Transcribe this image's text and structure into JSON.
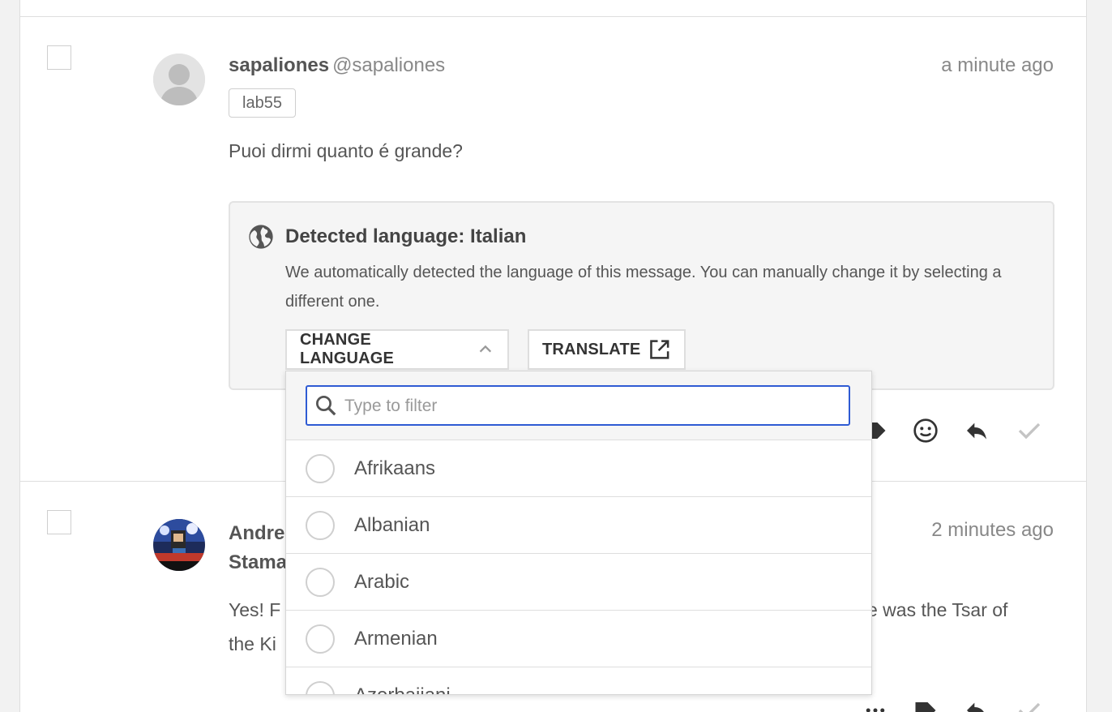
{
  "comments": [
    {
      "author": "sapaliones",
      "handle": "@sapaliones",
      "time": "a minute ago",
      "tag": "lab55",
      "message": "Puoi dirmi quanto é grande?",
      "language_box": {
        "title": "Detected language: Italian",
        "description": "We automatically detected the language of this message. You can manually change it by selecting a different one.",
        "change_button": "CHANGE LANGUAGE",
        "translate_button": "TRANSLATE"
      }
    },
    {
      "author_line1": "Andre",
      "author_line2": "Stama",
      "time": "2 minutes ago",
      "message_line1_start": "Yes! F",
      "message_line1_end": "e was the Tsar of",
      "message_line2_start": "the Ki"
    }
  ],
  "dropdown": {
    "placeholder": "Type to filter",
    "options": [
      "Afrikaans",
      "Albanian",
      "Arabic",
      "Armenian",
      "Azerbaijani"
    ]
  },
  "icons": {
    "globe": "globe-icon",
    "chevron": "chevron-up-icon",
    "external": "external-link-icon",
    "search": "search-icon",
    "emoji": "emoji-icon",
    "reply": "reply-icon",
    "check": "check-icon",
    "tag": "tag-icon"
  },
  "colors": {
    "focus_border": "#2f5bd3",
    "muted_text": "#888888"
  }
}
